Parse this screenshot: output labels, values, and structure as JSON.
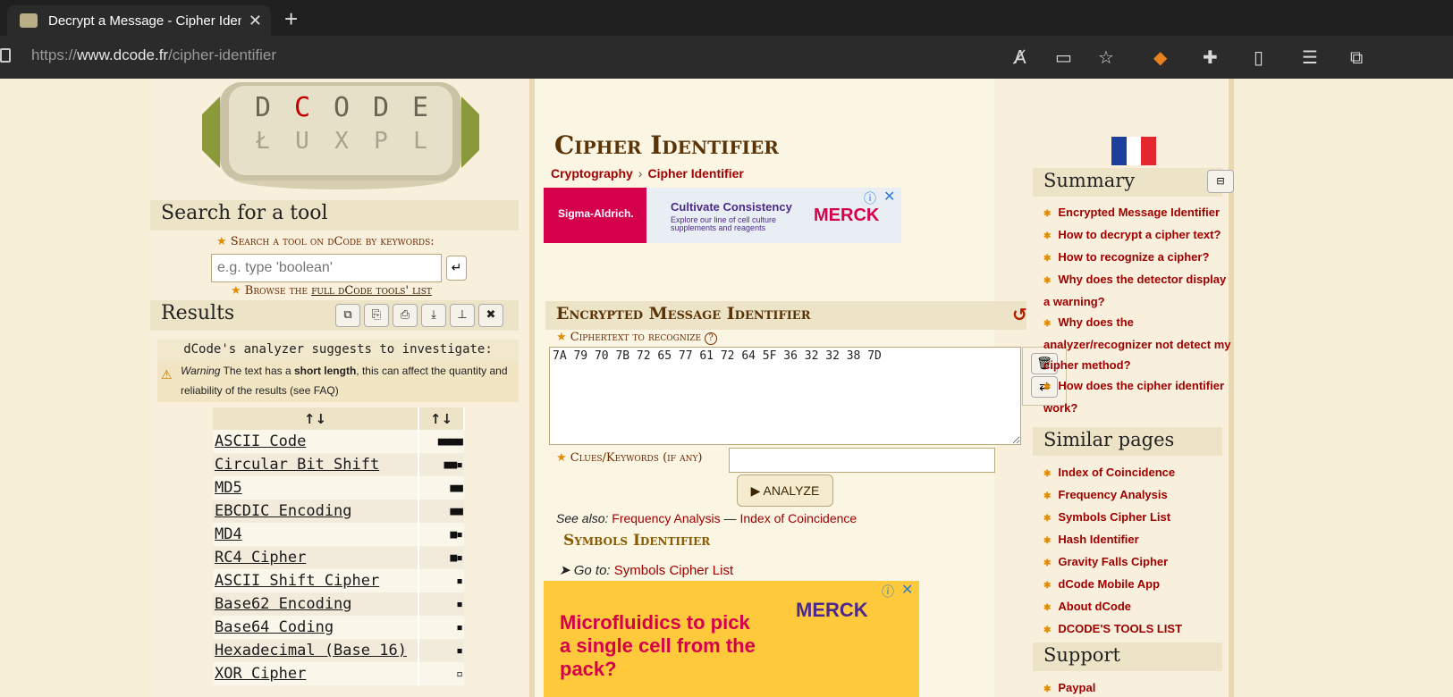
{
  "browser": {
    "tab_title": "Decrypt a Message - Cipher Iden",
    "url_scheme": "https://",
    "url_host": "www.dcode.fr",
    "url_path": "/cipher-identifier",
    "close_glyph": "✕",
    "newtab_glyph": "+"
  },
  "toolbar_icons": [
    "read-aloud-icon",
    "immersive-reader-icon",
    "favorite-star-icon",
    "metamask-icon",
    "extensions-icon",
    "split-screen-icon",
    "favorites-icon",
    "collections-icon"
  ],
  "logo": {
    "letters": "DCODE"
  },
  "search": {
    "heading": "Search for a tool",
    "label": "Search a tool on dCode by keywords:",
    "placeholder": "e.g. type 'boolean'",
    "go_glyph": "↵",
    "browse_prefix": "Browse the ",
    "browse_link": "full dCode tools' list"
  },
  "results": {
    "heading": "Results",
    "analyzer_text": "dCode's analyzer suggests to investigate:",
    "warning_label": "Warning",
    "warning_text_1": " The text has a ",
    "warning_bold": "short length",
    "warning_text_2": ", this can affect the quantity and reliability of the results (see FAQ)",
    "col_name": "↑↓",
    "col_score": "↑↓",
    "rows": [
      {
        "name": "ASCII Code",
        "score": "■■■■"
      },
      {
        "name": "Circular Bit Shift",
        "score": "■■▪"
      },
      {
        "name": "MD5",
        "score": "■■"
      },
      {
        "name": "EBCDIC Encoding",
        "score": "■■"
      },
      {
        "name": "MD4",
        "score": "■▪"
      },
      {
        "name": "RC4 Cipher",
        "score": "■▪"
      },
      {
        "name": "ASCII Shift Cipher",
        "score": "▪"
      },
      {
        "name": "Base62 Encoding",
        "score": "▪"
      },
      {
        "name": "Base64 Coding",
        "score": "▪"
      },
      {
        "name": "Hexadecimal (Base 16)",
        "score": "▪"
      },
      {
        "name": "XOR Cipher",
        "score": "▫"
      }
    ]
  },
  "main": {
    "title": "Cipher Identifier",
    "breadcrumb_1": "Cryptography",
    "breadcrumb_sep": "›",
    "breadcrumb_2": "Cipher Identifier",
    "ad1": {
      "brand": "Sigma-Aldrich.",
      "headline": "Cultivate Consistency",
      "sub": "Explore our line of cell culture supplements and reagents",
      "logo": "MERCK"
    },
    "emi_heading": "Encrypted Message Identifier",
    "ciphertext_label": "Ciphertext to recognize",
    "ciphertext_value": "7A 79 70 7B 72 65 77 61 72 64 5F 36 32 32 38 7D",
    "clues_label": "Clues/Keywords (if any)",
    "analyze_label": "▶ ANALYZE",
    "see_also": "See also:",
    "see_also_1": "Frequency Analysis",
    "see_also_sep": " — ",
    "see_also_2": "Index of Coincidence",
    "symbols_heading": "Symbols Identifier",
    "goto_prefix": "➤ Go to:",
    "goto_link": "Symbols Cipher List",
    "ad2": {
      "text": "Microfluidics to pick a single cell from the pack?",
      "logo": "MERCK"
    }
  },
  "sidebar": {
    "summary_heading": "Summary",
    "summary_items": [
      "Encrypted Message Identifier",
      "How to decrypt a cipher text?",
      "How to recognize a cipher?",
      "Why does the detector display a warning?",
      "Why does the analyzer/recognizer not detect my cipher method?",
      "How does the cipher identifier work?"
    ],
    "similar_heading": "Similar pages",
    "similar_items": [
      "Index of Coincidence",
      "Frequency Analysis",
      "Symbols Cipher List",
      "Hash Identifier",
      "Gravity Falls Cipher",
      "dCode Mobile App",
      "About dCode",
      "DCODE'S TOOLS LIST"
    ],
    "support_heading": "Support",
    "support_items": [
      "Paypal"
    ]
  },
  "colors": {
    "accent": "#a00000",
    "heading": "#5a3306",
    "chrome": "#1f1f1f"
  }
}
